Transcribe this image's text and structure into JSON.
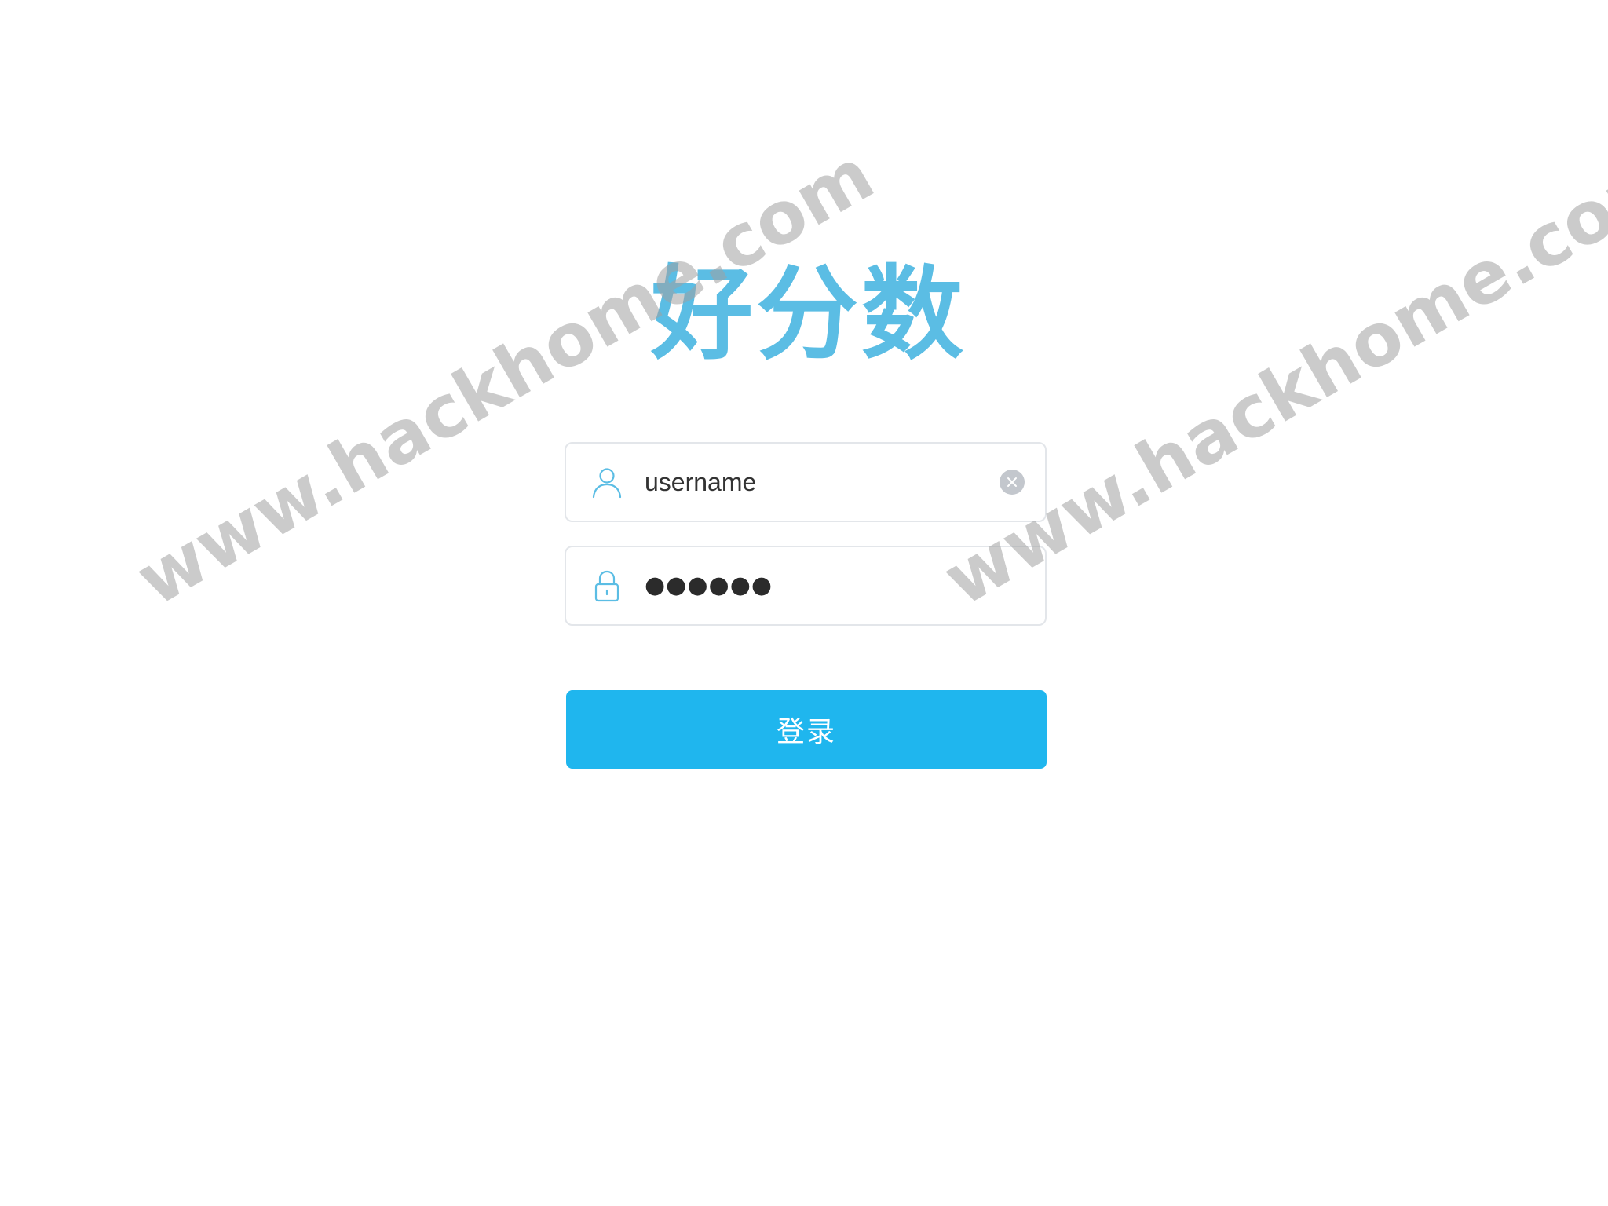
{
  "brand": {
    "logo_text": "好分数",
    "logo_color": "#5bbde4"
  },
  "login_form": {
    "username": {
      "value": "username",
      "icon": "user-icon",
      "clear_icon": "clear-icon"
    },
    "password": {
      "masked_value": "●●●●●●",
      "icon": "lock-icon"
    },
    "submit_label": "登录",
    "accent_color": "#1fb6ee",
    "icon_color": "#5bbde4"
  },
  "watermarks": [
    {
      "text": "www.hackhome.com"
    },
    {
      "text": "www.hackhome.com"
    }
  ]
}
